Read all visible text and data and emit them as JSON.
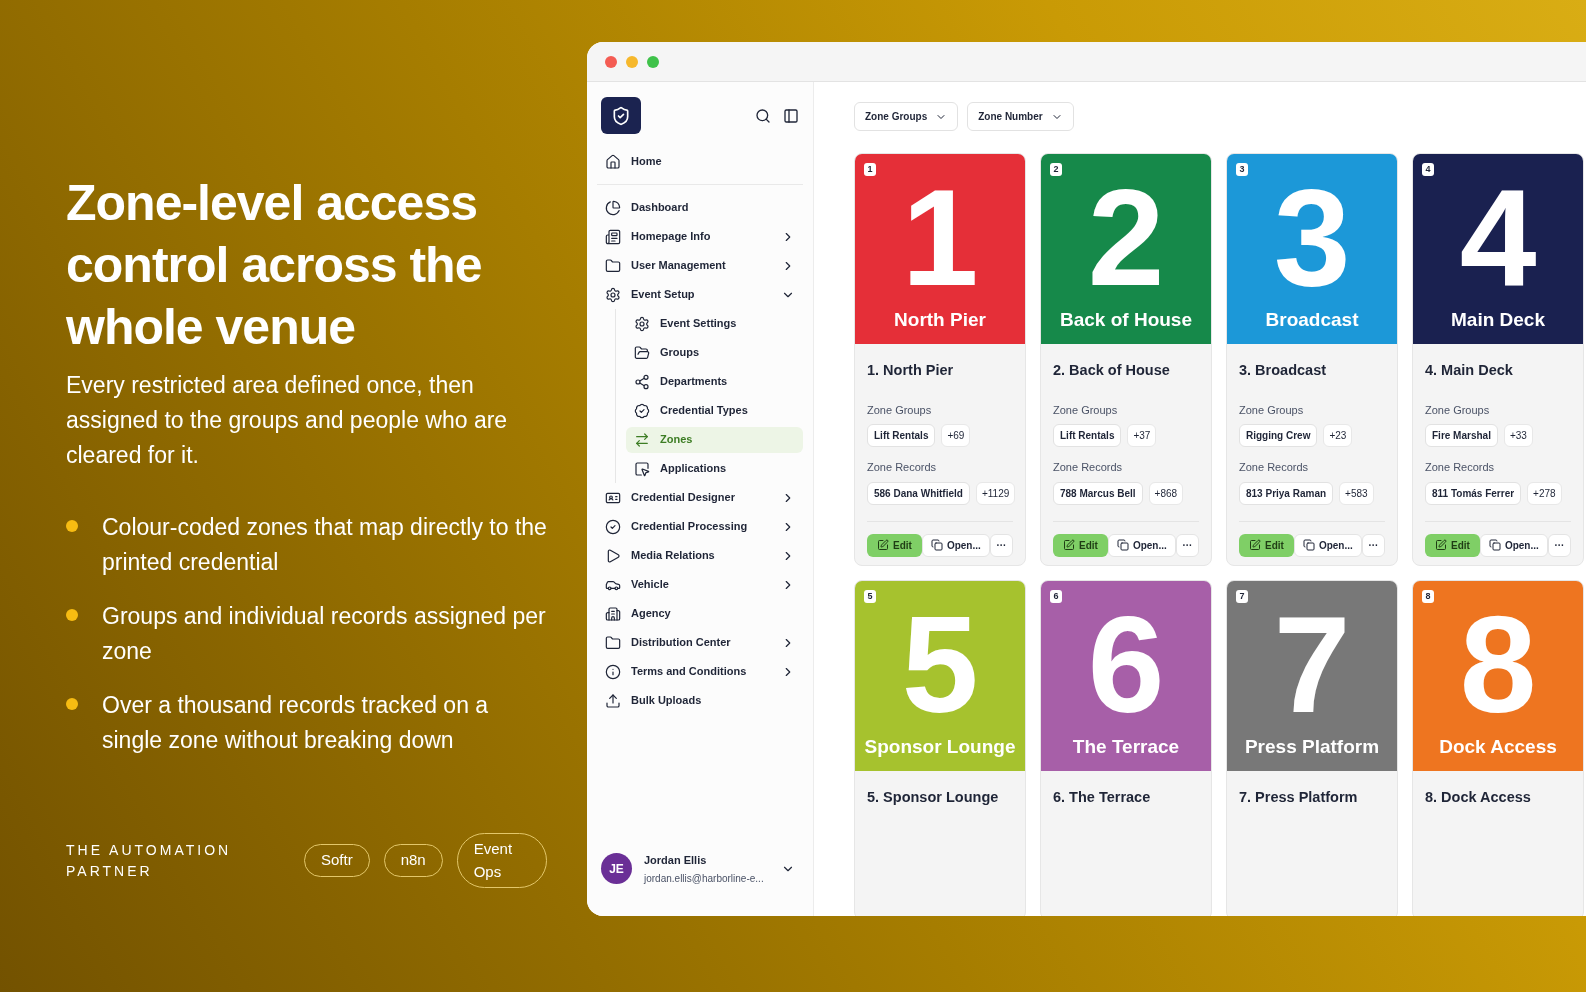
{
  "hero": {
    "title": "Zone-level access control across the whole venue",
    "description": "Every restricted area defined once, then assigned to the groups and people who are cleared for it.",
    "bullets": [
      "Colour-coded zones that map directly to the printed credential",
      "Groups and individual records assigned per zone",
      "Over a thousand records tracked on a single zone without breaking down"
    ],
    "footer": {
      "label": "THE AUTOMATION PARTNER",
      "tags": [
        "Softr",
        "n8n",
        "Event Ops"
      ]
    }
  },
  "sidebar": {
    "items": [
      {
        "label": "Home",
        "kind": "link",
        "selected": false
      },
      {
        "label": "Dashboard",
        "kind": "link",
        "selected": false
      },
      {
        "label": "Homepage Info",
        "kind": "menu",
        "expanded": false,
        "selected": false
      },
      {
        "label": "User Management",
        "kind": "menu",
        "expanded": false,
        "selected": false
      },
      {
        "label": "Event Setup",
        "kind": "menu",
        "expanded": true,
        "selected": false,
        "children": [
          {
            "label": "Event Settings",
            "selected": false
          },
          {
            "label": "Groups",
            "selected": false
          },
          {
            "label": "Departments",
            "selected": false
          },
          {
            "label": "Credential Types",
            "selected": false
          },
          {
            "label": "Zones",
            "selected": true
          },
          {
            "label": "Applications",
            "selected": false
          }
        ]
      },
      {
        "label": "Credential Designer",
        "kind": "menu",
        "expanded": false,
        "selected": false
      },
      {
        "label": "Credential Processing",
        "kind": "menu",
        "expanded": false,
        "selected": false
      },
      {
        "label": "Media Relations",
        "kind": "menu",
        "expanded": false,
        "selected": false
      },
      {
        "label": "Vehicle",
        "kind": "menu",
        "expanded": false,
        "selected": false
      },
      {
        "label": "Agency",
        "kind": "link",
        "selected": false
      },
      {
        "label": "Distribution Center",
        "kind": "menu",
        "expanded": false,
        "selected": false
      },
      {
        "label": "Terms and Conditions",
        "kind": "menu",
        "expanded": false,
        "selected": false
      },
      {
        "label": "Bulk Uploads",
        "kind": "link",
        "selected": false
      }
    ],
    "user": {
      "initials": "JE",
      "name": "Jordan Ellis",
      "email": "jordan.ellis@harborline-e..."
    }
  },
  "filters": [
    "Zone Groups",
    "Zone Number"
  ],
  "zones": [
    {
      "badge": "1",
      "numeral": "1",
      "banner": "North Pier",
      "title": "1. North Pier",
      "color": "#e52f38",
      "groups": {
        "label": "Zone Groups",
        "chip": "Lift Rentals",
        "more": "+69"
      },
      "records": {
        "label": "Zone Records",
        "chip": "586 Dana Whitfield",
        "more": "+1129"
      },
      "actions": [
        {
          "kind": "edit",
          "label": "Edit"
        },
        {
          "kind": "open",
          "label": "Open..."
        },
        {
          "kind": "more",
          "label": "···"
        }
      ]
    },
    {
      "badge": "2",
      "numeral": "2",
      "banner": "Back of House",
      "title": "2. Back of House",
      "color": "#16894a",
      "groups": {
        "label": "Zone Groups",
        "chip": "Lift Rentals",
        "more": "+37"
      },
      "records": {
        "label": "Zone Records",
        "chip": "788 Marcus Bell",
        "more": "+868"
      },
      "actions": [
        {
          "kind": "edit",
          "label": "Edit"
        },
        {
          "kind": "open",
          "label": "Open..."
        },
        {
          "kind": "more",
          "label": "···"
        }
      ]
    },
    {
      "badge": "3",
      "numeral": "3",
      "banner": "Broadcast",
      "title": "3. Broadcast",
      "color": "#1c98d8",
      "groups": {
        "label": "Zone Groups",
        "chip": "Rigging Crew",
        "more": "+23"
      },
      "records": {
        "label": "Zone Records",
        "chip": "813 Priya Raman",
        "more": "+583"
      },
      "actions": [
        {
          "kind": "edit",
          "label": "Edit"
        },
        {
          "kind": "open",
          "label": "Open..."
        },
        {
          "kind": "more",
          "label": "···"
        }
      ]
    },
    {
      "badge": "4",
      "numeral": "4",
      "banner": "Main Deck",
      "title": "4. Main Deck",
      "color": "#1a2150",
      "groups": {
        "label": "Zone Groups",
        "chip": "Fire Marshal",
        "more": "+33"
      },
      "records": {
        "label": "Zone Records",
        "chip": "811 Tomás Ferrer",
        "more": "+278"
      },
      "actions": [
        {
          "kind": "edit",
          "label": "Edit"
        },
        {
          "kind": "open",
          "label": "Open..."
        },
        {
          "kind": "more",
          "label": "···"
        }
      ]
    },
    {
      "badge": "5",
      "numeral": "5",
      "banner": "Sponsor Lounge",
      "title": "5. Sponsor Lounge",
      "color": "#a6c22e"
    },
    {
      "badge": "6",
      "numeral": "6",
      "banner": "The Terrace",
      "title": "6. The Terrace",
      "color": "#a75fa8"
    },
    {
      "badge": "7",
      "numeral": "7",
      "banner": "Press Platform",
      "title": "7. Press Platform",
      "color": "#787878"
    },
    {
      "badge": "8",
      "numeral": "8",
      "banner": "Dock Access",
      "title": "8. Dock Access",
      "color": "#ee7520"
    }
  ]
}
